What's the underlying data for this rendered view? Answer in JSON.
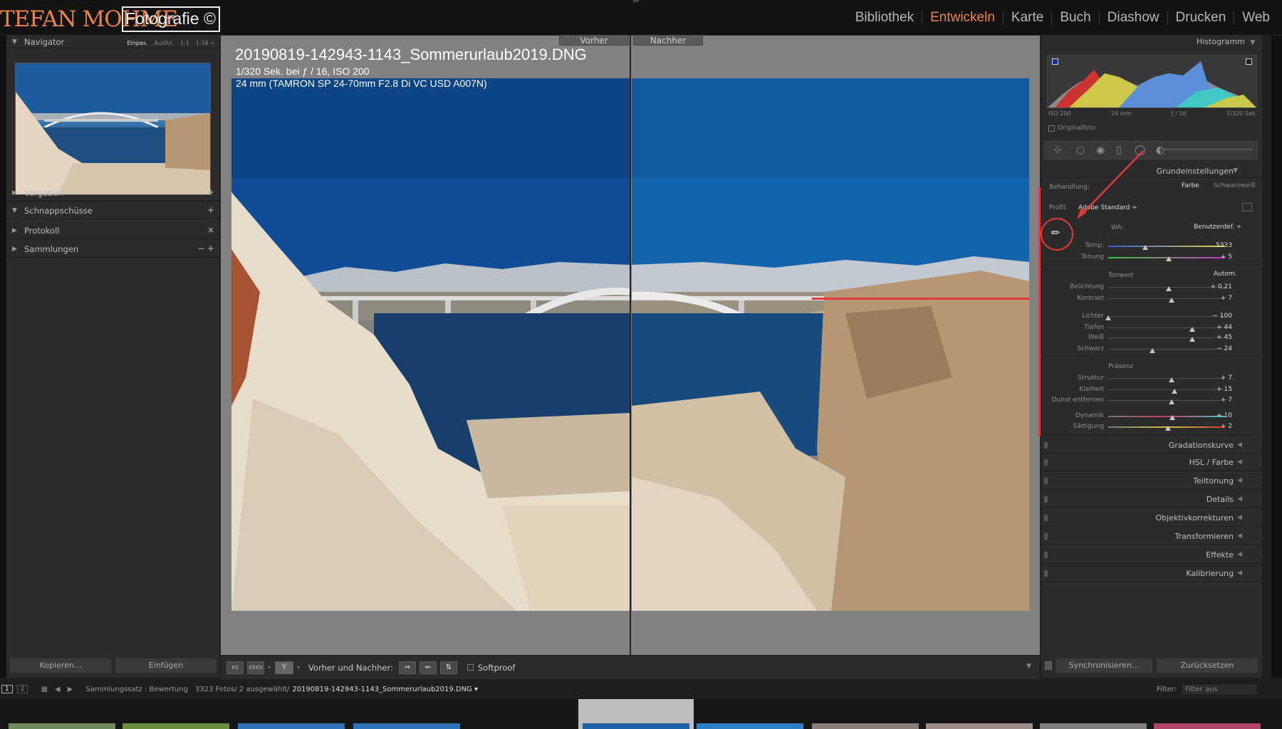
{
  "brand": {
    "script": "TEFAN MOHME",
    "box": "Fotografie ©"
  },
  "modules": [
    "Bibliothek",
    "Entwickeln",
    "Karte",
    "Buch",
    "Diashow",
    "Drucken",
    "Web"
  ],
  "active_module": "Entwickeln",
  "left_panel": {
    "navigator": {
      "title": "Navigator",
      "zoom": [
        "Einpas.",
        "Ausfül.",
        "1:1",
        "1:16 ÷"
      ]
    },
    "sections": [
      {
        "label": "Vorgaben",
        "action": "+"
      },
      {
        "label": "Schnappschüsse",
        "action": "+"
      },
      {
        "label": "Protokoll",
        "action": "×"
      },
      {
        "label": "Sammlungen",
        "action": "− +"
      }
    ],
    "copy": "Kopieren...",
    "paste": "Einfügen"
  },
  "view": {
    "before_label": "Vorher",
    "after_label": "Nachher",
    "filename": "20190819-142943-1143_Sommerurlaub2019.DNG",
    "exif_line1": "1/320 Sek. bei ƒ / 16, ISO 200",
    "exif_line2": "24 mm (TAMRON SP 24-70mm F2.8 Di VC USD A007N)"
  },
  "toolbar": {
    "compare_label": "Vorher und Nachher:",
    "softproof": "Softproof"
  },
  "right_panel": {
    "histogram": {
      "title": "Histogramm",
      "iso": "ISO 200",
      "focal": "24 mm",
      "aperture": "ƒ / 16",
      "shutter": "1/320 Sek.",
      "original": "Originalfoto"
    },
    "basic": {
      "title": "Grundeinstellungen",
      "treatment_label": "Behandlung:",
      "treatment_color": "Farbe",
      "treatment_bw": "Schwarzweiß",
      "profile_label": "Profil:",
      "profile_value": "Adobe Standard ÷",
      "wb_label": "WA:",
      "wb_value": "Benutzerdef. ÷",
      "tone_label": "Tonwert",
      "auto_label": "Autom.",
      "presence_label": "Präsenz",
      "sliders": {
        "temp": {
          "label": "Temp.",
          "value": "5333",
          "pos": 0.32
        },
        "tint": {
          "label": "Tonung",
          "value": "+ 5",
          "pos": 0.52
        },
        "exposure": {
          "label": "Belichtung",
          "value": "+ 0,21",
          "pos": 0.52
        },
        "contrast": {
          "label": "Kontrast",
          "value": "+ 7",
          "pos": 0.54
        },
        "highlights": {
          "label": "Lichter",
          "value": "− 100",
          "pos": 0.0
        },
        "shadows": {
          "label": "Tiefen",
          "value": "+ 44",
          "pos": 0.72
        },
        "whites": {
          "label": "Weiß",
          "value": "+ 45",
          "pos": 0.72
        },
        "blacks": {
          "label": "Schwarz",
          "value": "− 24",
          "pos": 0.38
        },
        "texture": {
          "label": "Struktur",
          "value": "+ 7",
          "pos": 0.54
        },
        "clarity": {
          "label": "Klarheit",
          "value": "+ 15",
          "pos": 0.57
        },
        "dehaze": {
          "label": "Dunst entfernen",
          "value": "+ 7",
          "pos": 0.54
        },
        "vibrance": {
          "label": "Dynamik",
          "value": "+ 10",
          "pos": 0.55
        },
        "saturation": {
          "label": "Sättigung",
          "value": "+ 2",
          "pos": 0.51
        }
      }
    },
    "collapsed": [
      "Gradationskurve",
      "HSL / Farbe",
      "Teiltonung",
      "Details",
      "Objektivkorrekturen",
      "Transformieren",
      "Effekte",
      "Kalibrierung"
    ],
    "sync": "Synchronisieren...",
    "reset": "Zurücksetzen"
  },
  "filmstrip": {
    "page1": "1",
    "page2": "2",
    "path_prefix": "Sammlungssatz : Bewertung",
    "count": "3323 Fotos/ 2 ausgewählt/",
    "file": "20190819-142943-1143_Sommerurlaub2019.DNG ▾",
    "filter_label": "Filter:",
    "filter_value": "Filter aus"
  },
  "colors": {
    "accent": "#e8844c",
    "annotation": "#e23a3a"
  }
}
